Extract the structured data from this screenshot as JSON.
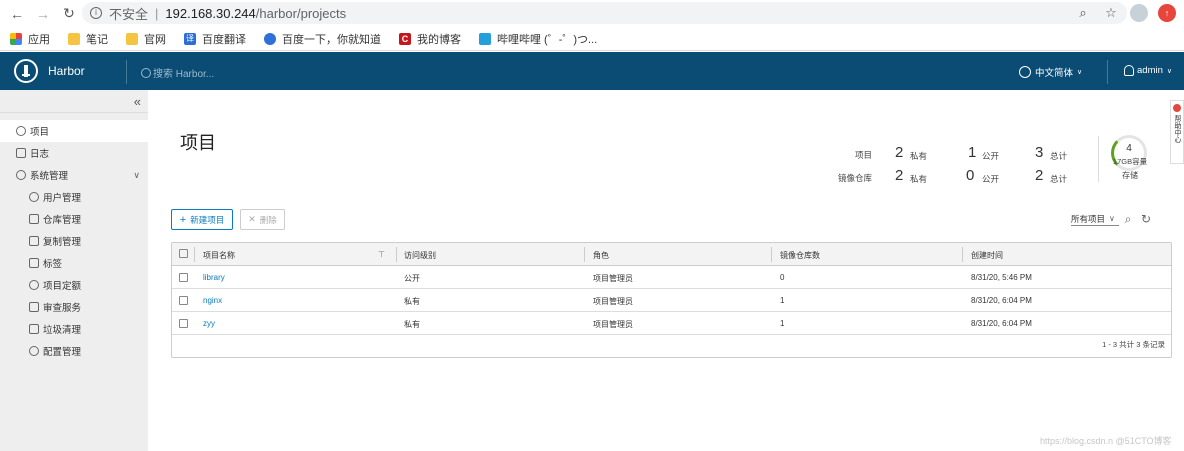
{
  "browser": {
    "insecure_label": "不安全",
    "url_host": "192.168.30.244",
    "url_path": "/harbor/projects",
    "bookmarks": [
      "应用",
      "笔记",
      "官网",
      "百度翻译",
      "百度一下，你就知道",
      "我的博客",
      "哔哩哔哩 (゜-゜)つ..."
    ]
  },
  "header": {
    "app_name": "Harbor",
    "search_placeholder": "搜索 Harbor...",
    "language": "中文简体",
    "user": "admin"
  },
  "sidebar": {
    "items": [
      {
        "label": "项目",
        "icon": "projects-icon",
        "active": true
      },
      {
        "label": "日志",
        "icon": "logs-icon"
      },
      {
        "label": "系统管理",
        "icon": "admin-icon"
      },
      {
        "label": "用户管理",
        "icon": "users-icon"
      },
      {
        "label": "仓库管理",
        "icon": "registries-icon"
      },
      {
        "label": "复制管理",
        "icon": "replication-icon"
      },
      {
        "label": "标签",
        "icon": "tag-icon"
      },
      {
        "label": "项目定额",
        "icon": "quota-icon"
      },
      {
        "label": "审查服务",
        "icon": "shield-icon"
      },
      {
        "label": "垃圾清理",
        "icon": "trash-icon"
      },
      {
        "label": "配置管理",
        "icon": "gear-icon"
      }
    ]
  },
  "main": {
    "title": "项目",
    "stats": {
      "row_labels": [
        "项目",
        "镜像仓库"
      ],
      "private_label": "私有",
      "public_label": "公开",
      "total_label": "总计",
      "projects": {
        "private": "2",
        "public": "1",
        "total": "3"
      },
      "repos": {
        "private": "2",
        "public": "0",
        "total": "2"
      },
      "storage_count": "4",
      "storage_capacity": "17GB容量",
      "storage_label": "存储",
      "storage_fraction": 0.25
    },
    "new_project_label": "新建项目",
    "delete_label": "删除",
    "filter_value": "所有项目",
    "table": {
      "columns": [
        "项目名称",
        "访问级别",
        "角色",
        "镜像仓库数",
        "创建时间"
      ],
      "rows": [
        {
          "name": "library",
          "access": "公开",
          "role": "项目管理员",
          "repos": "0",
          "created": "8/31/20, 5:46 PM"
        },
        {
          "name": "nginx",
          "access": "私有",
          "role": "项目管理员",
          "repos": "1",
          "created": "8/31/20, 6:04 PM"
        },
        {
          "name": "zyy",
          "access": "私有",
          "role": "项目管理员",
          "repos": "1",
          "created": "8/31/20, 6:04 PM"
        }
      ],
      "footer": "1 - 3 共计 3 条记录"
    }
  },
  "feedback_label": "帮助中心",
  "watermark": "https://blog.csdn.n @51CTO博客"
}
